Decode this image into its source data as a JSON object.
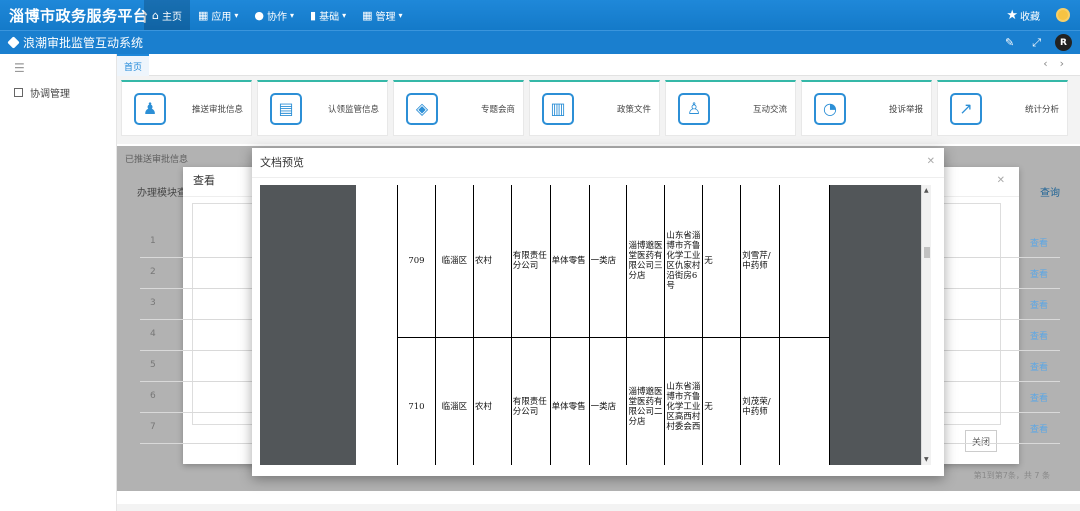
{
  "topbar": {
    "brand": "淄博市政务服务平台",
    "nav": [
      {
        "icon": "home-icon",
        "glyph": "⌂",
        "label": "主页"
      },
      {
        "icon": "grid-icon",
        "glyph": "▦",
        "label": "应用"
      },
      {
        "icon": "link-icon",
        "glyph": "●",
        "label": "协作"
      },
      {
        "icon": "chart-icon",
        "glyph": "▮",
        "label": "基础"
      },
      {
        "icon": "manage-icon",
        "glyph": "▦",
        "label": "管理"
      }
    ],
    "favorite": "收藏"
  },
  "subbar": {
    "system_name": "浪潮审批监管互动系统",
    "avatar_letter": "R"
  },
  "sidebar": {
    "items": [
      {
        "label": "协调管理"
      }
    ]
  },
  "tabs": {
    "home": "首页"
  },
  "cards": [
    {
      "label": "推送审批信息",
      "icon": "user-stamp-icon",
      "glyph": "♟"
    },
    {
      "label": "认领监管信息",
      "icon": "document-icon",
      "glyph": "▤"
    },
    {
      "label": "专题会商",
      "icon": "layers-icon",
      "glyph": "◈"
    },
    {
      "label": "政策文件",
      "icon": "book-icon",
      "glyph": "▥"
    },
    {
      "label": "互动交流",
      "icon": "chat-icon",
      "glyph": "♙"
    },
    {
      "label": "投诉举报",
      "icon": "shield-icon",
      "glyph": "◔"
    },
    {
      "label": "统计分析",
      "icon": "trend-icon",
      "glyph": "↗"
    }
  ],
  "background_panel": {
    "breadcrumb": "已推送审批信息",
    "module_label": "办理模块查",
    "query": "查询"
  },
  "background_rows": [
    {
      "n": "1",
      "op": "查看"
    },
    {
      "n": "2",
      "op": "查看"
    },
    {
      "n": "3",
      "op": "查看"
    },
    {
      "n": "4",
      "op": "查看"
    },
    {
      "n": "5",
      "op": "查看"
    },
    {
      "n": "6",
      "op": "查看"
    },
    {
      "n": "7",
      "op": "查看"
    }
  ],
  "pager_text": "第1到第7条，共 7 条",
  "view_dialog": {
    "title": "查看",
    "close_label": "关闭"
  },
  "doc_modal": {
    "title": "文档预览"
  },
  "doc_rows": [
    {
      "no": "709",
      "district": "临淄区",
      "area": "农村",
      "type": "有限责任分公司",
      "biz": "单体零售",
      "cls": "一类店",
      "name": "淄博邈医堂医药有限公司三分店",
      "addr": "山东省淄博市齐鲁化学工业区仇家村沿街房6号",
      "chain": "无",
      "qp": "刘雪芹/中药师",
      "last": ""
    },
    {
      "no": "710",
      "district": "临淄区",
      "area": "农村",
      "type": "有限责任分公司",
      "biz": "单体零售",
      "cls": "一类店",
      "name": "淄博邈医堂医药有限公司二分店",
      "addr": "山东省淄博市齐鲁化学工业区高西村村委会西",
      "chain": "无",
      "qp": "刘茂荣/中药师",
      "last": ""
    }
  ]
}
